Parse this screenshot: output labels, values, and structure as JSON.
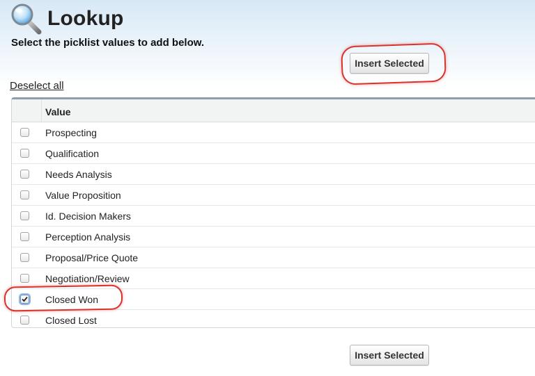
{
  "header": {
    "title": "Lookup",
    "icon": "magnifier-icon"
  },
  "instruction": "Select the picklist values to add below.",
  "buttons": {
    "insert_selected_top": "Insert Selected",
    "insert_selected_bottom": "Insert Selected"
  },
  "deselect_all": "Deselect all",
  "table": {
    "column_header": "Value",
    "rows": [
      {
        "label": "Prospecting",
        "checked": false
      },
      {
        "label": "Qualification",
        "checked": false
      },
      {
        "label": "Needs Analysis",
        "checked": false
      },
      {
        "label": "Value Proposition",
        "checked": false
      },
      {
        "label": "Id. Decision Makers",
        "checked": false
      },
      {
        "label": "Perception Analysis",
        "checked": false
      },
      {
        "label": "Proposal/Price Quote",
        "checked": false
      },
      {
        "label": "Negotiation/Review",
        "checked": false
      },
      {
        "label": "Closed Won",
        "checked": true
      },
      {
        "label": "Closed Lost",
        "checked": false
      }
    ]
  },
  "colors": {
    "annotation": "#d8322c",
    "header_gradient_top": "#d7e8f5",
    "focus_ring": "#8db8e8"
  }
}
